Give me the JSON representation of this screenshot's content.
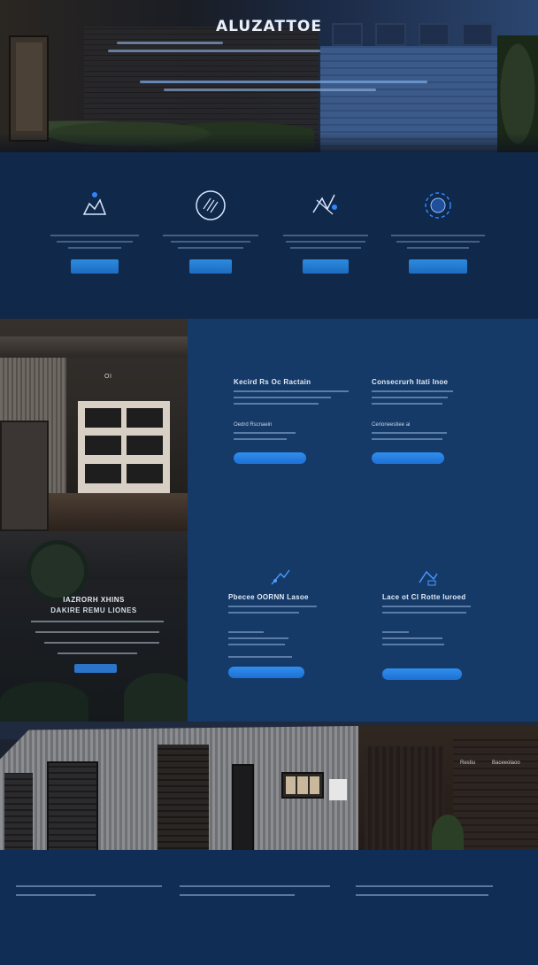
{
  "hero": {
    "title": "ALUZATTOE"
  },
  "features": [
    {
      "icon": "hand-remote-icon",
      "label": "",
      "button": ""
    },
    {
      "icon": "garage-door-icon",
      "label": "",
      "button": ""
    },
    {
      "icon": "tools-icon",
      "label": "",
      "button": ""
    },
    {
      "icon": "globe-icon",
      "label": "",
      "button": ""
    }
  ],
  "photo_a": {
    "sign": "OI"
  },
  "photo_b": {
    "title_line1": "IAZRORH XHINS",
    "title_line2": "DAKIRE REMU LIONES",
    "button": ""
  },
  "cards": [
    {
      "title": "Kecird Rs Oc Ractain",
      "sub": "Oedrd Rscnaein",
      "button": ""
    },
    {
      "title": "Consecrurh Itati Inoe",
      "sub": "Cerioneestiee ai",
      "button": ""
    },
    {
      "title": "Pbecee OORNN Lasoe",
      "sub": "",
      "button": ""
    },
    {
      "title": "Lace ot CI Rotte Iuroed",
      "sub": "",
      "button": ""
    }
  ],
  "bottom_photo": {
    "label1": "Restiu",
    "label2": "Baceeolaoo"
  },
  "colors": {
    "background": "#0c2341",
    "panel": "#153a68",
    "accent": "#1f78e0"
  }
}
